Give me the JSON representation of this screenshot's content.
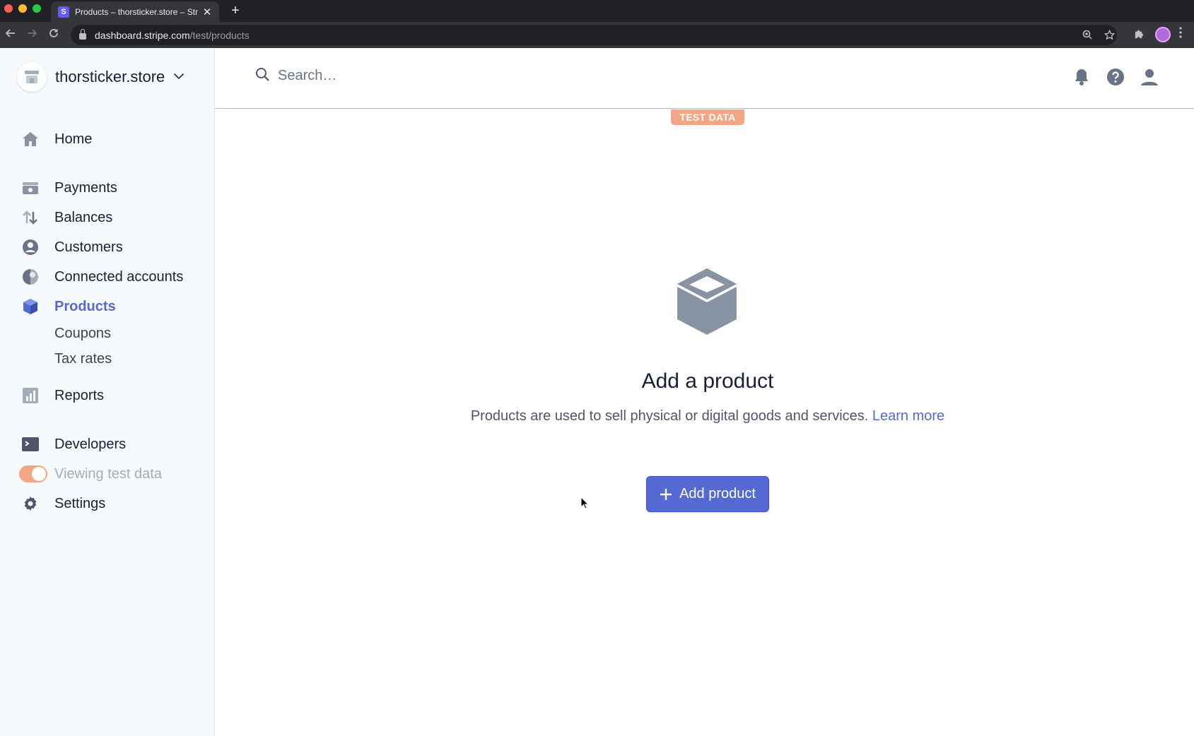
{
  "browser": {
    "tab_title": "Products – thorsticker.store – Stripe",
    "favicon_letter": "S",
    "close_glyph": "✕",
    "new_tab_glyph": "+",
    "url_host": "dashboard.stripe.com",
    "url_path": "/test/products"
  },
  "sidebar": {
    "account_name": "thorsticker.store",
    "items": {
      "home": "Home",
      "payments": "Payments",
      "balances": "Balances",
      "customers": "Customers",
      "connected_accounts": "Connected accounts",
      "products": "Products",
      "coupons": "Coupons",
      "tax_rates": "Tax rates",
      "reports": "Reports",
      "developers": "Developers",
      "viewing_test_data": "Viewing test data",
      "settings": "Settings"
    },
    "active_item": "products",
    "test_mode_on": true
  },
  "header": {
    "search_placeholder": "Search…"
  },
  "test_badge": "TEST DATA",
  "empty_state": {
    "title": "Add a product",
    "description": "Products are used to sell physical or digital goods and services.",
    "learn_more": "Learn more",
    "add_button_label": "Add product"
  },
  "colors": {
    "accent": "#5469d4",
    "test_mode": "#f5a484",
    "icon_gray": "#8792a2"
  }
}
